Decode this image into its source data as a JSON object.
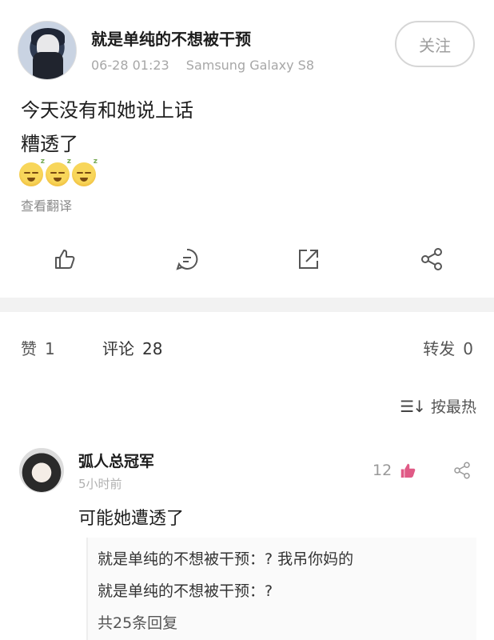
{
  "post": {
    "username": "就是单纯的不想被干预",
    "time": "06-28 01:23",
    "device": "Samsung Galaxy S8",
    "follow_label": "关注",
    "text_line1": "今天没有和她说上话",
    "text_line2": "糟透了",
    "emojis": [
      "sleepy-emoji",
      "sleepy-emoji",
      "sleepy-emoji"
    ],
    "translate_label": "查看翻译",
    "actions": [
      "like-icon",
      "comment-icon",
      "repost-icon",
      "share-icon"
    ]
  },
  "stats": {
    "like_label": "赞",
    "like_count": "1",
    "comment_label": "评论",
    "comment_count": "28",
    "repost_label": "转发",
    "repost_count": "0"
  },
  "sort": {
    "label": "按最热",
    "icon": "sort-icon"
  },
  "comment": {
    "username": "弧人总冠军",
    "time": "5小时前",
    "like_count": "12",
    "text": "可能她遭透了",
    "replies": [
      "就是单纯的不想被干预：? 我吊你妈的",
      "就是单纯的不想被干预：?"
    ],
    "reply_count_label": "共25条回复"
  },
  "colors": {
    "like_pink": "#e05a86",
    "muted_gray": "#a7a7a7",
    "gap_gray": "#f2f2f2"
  }
}
